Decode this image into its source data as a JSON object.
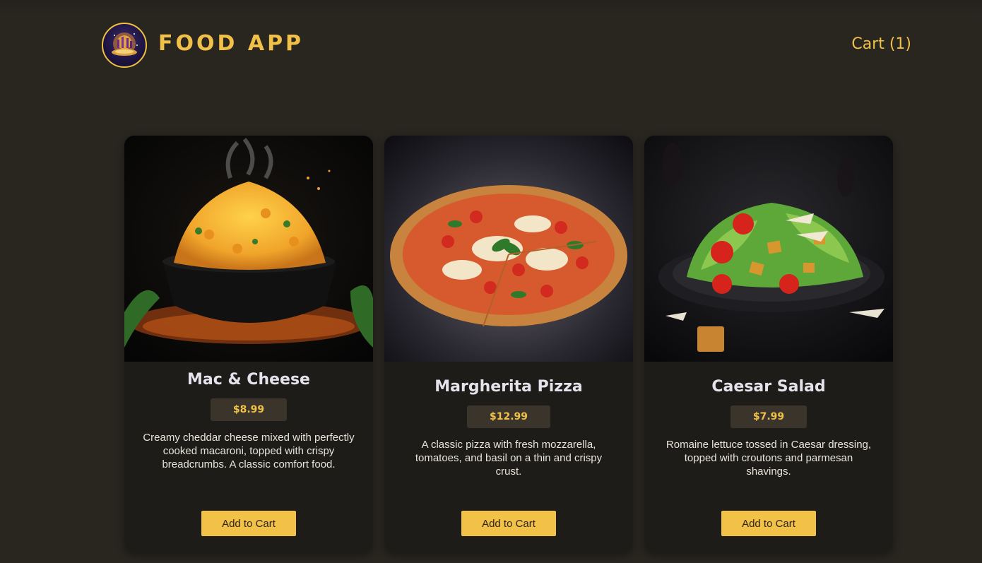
{
  "header": {
    "brand": "FOOD APP",
    "cart_label": "Cart (1)"
  },
  "colors": {
    "accent": "#f0c048",
    "background": "#29251f",
    "card": "#1e1c18",
    "price_bg": "#3a342a"
  },
  "products": [
    {
      "name": "Mac & Cheese",
      "price": "$8.99",
      "description": "Creamy cheddar cheese mixed with perfectly cooked macaroni, topped with crispy breadcrumbs. A classic comfort food.",
      "button": "Add to Cart",
      "image": "mac-and-cheese-photo"
    },
    {
      "name": "Margherita Pizza",
      "price": "$12.99",
      "description": "A classic pizza with fresh mozzarella, tomatoes, and basil on a thin and crispy crust.",
      "button": "Add to Cart",
      "image": "margherita-pizza-photo"
    },
    {
      "name": "Caesar Salad",
      "price": "$7.99",
      "description": "Romaine lettuce tossed in Caesar dressing, topped with croutons and parmesan shavings.",
      "button": "Add to Cart",
      "image": "caesar-salad-photo"
    }
  ]
}
